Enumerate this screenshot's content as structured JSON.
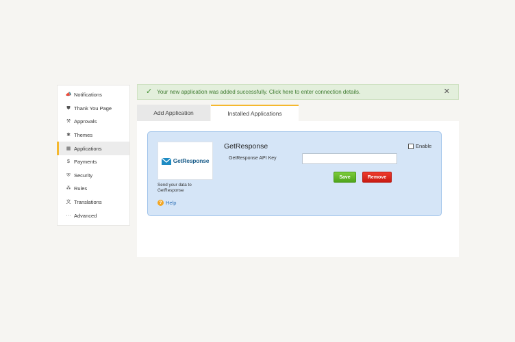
{
  "sidebar": {
    "items": [
      {
        "label": "Notifications",
        "icon": "megaphone-icon",
        "glyph": "📣"
      },
      {
        "label": "Thank You Page",
        "icon": "shield-icon",
        "glyph": "⛊"
      },
      {
        "label": "Approvals",
        "icon": "gavel-icon",
        "glyph": "⚒"
      },
      {
        "label": "Themes",
        "icon": "palette-icon",
        "glyph": "✱"
      },
      {
        "label": "Applications",
        "icon": "grid-icon",
        "glyph": "▦"
      },
      {
        "label": "Payments",
        "icon": "dollar-icon",
        "glyph": "$"
      },
      {
        "label": "Security",
        "icon": "shield-check-icon",
        "glyph": "⛨"
      },
      {
        "label": "Rules",
        "icon": "rules-icon",
        "glyph": "⁂"
      },
      {
        "label": "Translations",
        "icon": "translate-icon",
        "glyph": "文"
      },
      {
        "label": "Advanced",
        "icon": "ellipsis-icon",
        "glyph": "···"
      }
    ],
    "active_index": 4
  },
  "alert": {
    "message": "Your new application was added successfully. Click here to enter connection details.",
    "check_glyph": "✓",
    "close_glyph": "✕"
  },
  "tabs": [
    {
      "label": "Add Application"
    },
    {
      "label": "Installed Applications"
    }
  ],
  "app": {
    "logo_text": "GetResponse",
    "description": "Send your data to GetResponse",
    "help_label": "Help",
    "help_glyph": "?",
    "title": "GetResponse",
    "api_key_label": "GetResponse API Key",
    "api_key_value": "",
    "enable_label": "Enable",
    "enabled": false,
    "save_label": "Save",
    "remove_label": "Remove"
  },
  "colors": {
    "accent": "#f5b82e",
    "alert_bg": "#e3efdc",
    "card_bg": "#d5e5f7",
    "save": "#5cb526",
    "remove": "#d9231a"
  }
}
